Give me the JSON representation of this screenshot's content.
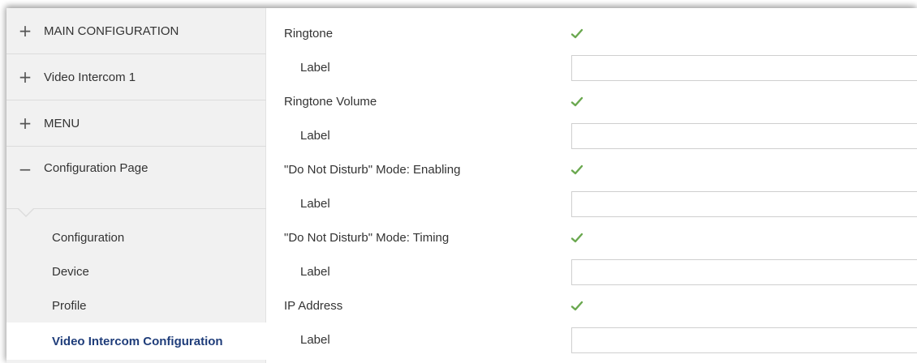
{
  "sidebar": {
    "sections": [
      {
        "symbol": "+",
        "label": "MAIN CONFIGURATION"
      },
      {
        "symbol": "+",
        "label": "Video Intercom 1"
      },
      {
        "symbol": "+",
        "label": "MENU"
      },
      {
        "symbol": "−",
        "label": "Configuration Page"
      }
    ],
    "subitems": [
      {
        "label": "Configuration"
      },
      {
        "label": "Device"
      },
      {
        "label": "Profile"
      },
      {
        "label": "Video Intercom Configuration",
        "active": true
      }
    ]
  },
  "form": {
    "rows": [
      {
        "label": "Ringtone",
        "checked": true
      },
      {
        "label": "Label",
        "value": ""
      },
      {
        "label": "Ringtone Volume",
        "checked": true
      },
      {
        "label": "Label",
        "value": ""
      },
      {
        "label": "\"Do Not Disturb\" Mode: Enabling",
        "checked": true
      },
      {
        "label": "Label",
        "value": ""
      },
      {
        "label": "\"Do Not Disturb\" Mode: Timing",
        "checked": true
      },
      {
        "label": "Label",
        "value": ""
      },
      {
        "label": "IP Address",
        "checked": true
      },
      {
        "label": "Label",
        "value": ""
      }
    ]
  },
  "colors": {
    "sidebar_bg": "#f1f1f1",
    "active_text": "#1f3d7a",
    "check": "#6aa84f"
  }
}
